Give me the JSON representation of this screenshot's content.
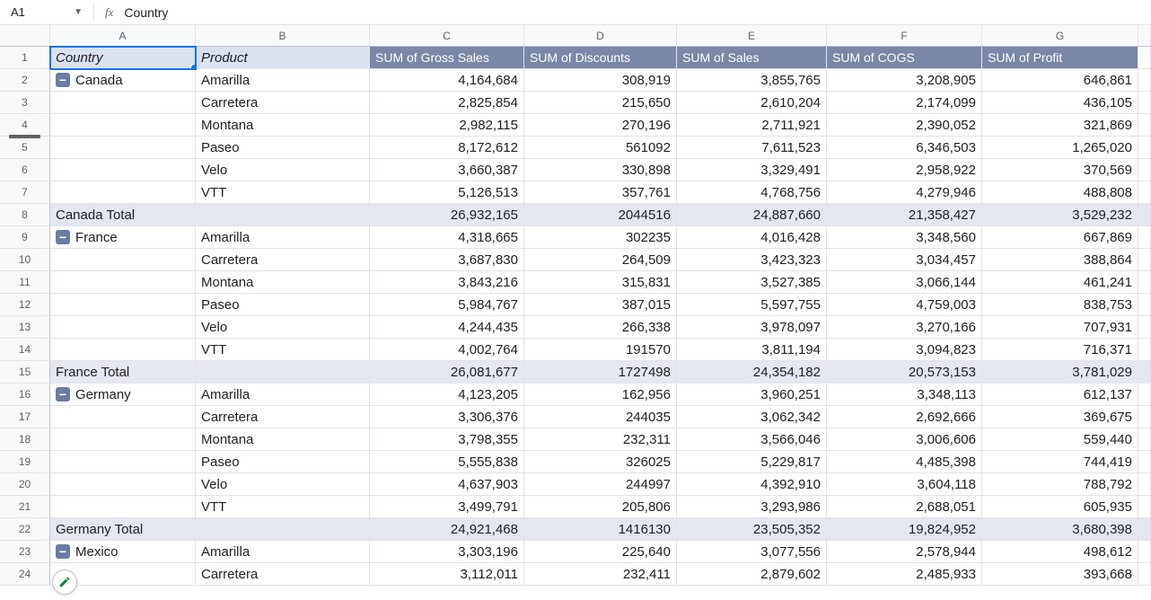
{
  "namebox": {
    "ref": "A1"
  },
  "formula_bar": {
    "fx_label": "fx",
    "value": "Country"
  },
  "columns": [
    "A",
    "B",
    "C",
    "D",
    "E",
    "F",
    "G"
  ],
  "headers": {
    "country_label": "Country",
    "product_label": "Product",
    "metrics": [
      "SUM of Gross Sales",
      "SUM of Discounts",
      "SUM of Sales",
      "SUM of COGS",
      "SUM of Profit"
    ]
  },
  "row_numbers": [
    1,
    2,
    3,
    4,
    5,
    6,
    7,
    8,
    9,
    10,
    11,
    12,
    13,
    14,
    15,
    16,
    17,
    18,
    19,
    20,
    21,
    22,
    23,
    24
  ],
  "rows": [
    {
      "type": "product",
      "r": 2,
      "country": "Canada",
      "first": true,
      "product": "Amarilla",
      "vals": [
        "4,164,684",
        "308,919",
        "3,855,765",
        "3,208,905",
        "646,861"
      ]
    },
    {
      "type": "product",
      "r": 3,
      "product": "Carretera",
      "vals": [
        "2,825,854",
        "215,650",
        "2,610,204",
        "2,174,099",
        "436,105"
      ]
    },
    {
      "type": "product",
      "r": 4,
      "product": "Montana",
      "vals": [
        "2,982,115",
        "270,196",
        "2,711,921",
        "2,390,052",
        "321,869"
      ]
    },
    {
      "type": "product",
      "r": 5,
      "product": "Paseo",
      "vals": [
        "8,172,612",
        "561092",
        "7,611,523",
        "6,346,503",
        "1,265,020"
      ]
    },
    {
      "type": "product",
      "r": 6,
      "product": "Velo",
      "vals": [
        "3,660,387",
        "330,898",
        "3,329,491",
        "2,958,922",
        "370,569"
      ]
    },
    {
      "type": "product",
      "r": 7,
      "product": "VTT",
      "vals": [
        "5,126,513",
        "357,761",
        "4,768,756",
        "4,279,946",
        "488,808"
      ]
    },
    {
      "type": "total",
      "r": 8,
      "label": "Canada Total",
      "vals": [
        "26,932,165",
        "2044516",
        "24,887,660",
        "21,358,427",
        "3,529,232"
      ]
    },
    {
      "type": "product",
      "r": 9,
      "country": "France",
      "first": true,
      "product": "Amarilla",
      "vals": [
        "4,318,665",
        "302235",
        "4,016,428",
        "3,348,560",
        "667,869"
      ]
    },
    {
      "type": "product",
      "r": 10,
      "product": "Carretera",
      "vals": [
        "3,687,830",
        "264,509",
        "3,423,323",
        "3,034,457",
        "388,864"
      ]
    },
    {
      "type": "product",
      "r": 11,
      "product": "Montana",
      "vals": [
        "3,843,216",
        "315,831",
        "3,527,385",
        "3,066,144",
        "461,241"
      ]
    },
    {
      "type": "product",
      "r": 12,
      "product": "Paseo",
      "vals": [
        "5,984,767",
        "387,015",
        "5,597,755",
        "4,759,003",
        "838,753"
      ]
    },
    {
      "type": "product",
      "r": 13,
      "product": "Velo",
      "vals": [
        "4,244,435",
        "266,338",
        "3,978,097",
        "3,270,166",
        "707,931"
      ]
    },
    {
      "type": "product",
      "r": 14,
      "product": "VTT",
      "vals": [
        "4,002,764",
        "191570",
        "3,811,194",
        "3,094,823",
        "716,371"
      ]
    },
    {
      "type": "total",
      "r": 15,
      "label": "France Total",
      "vals": [
        "26,081,677",
        "1727498",
        "24,354,182",
        "20,573,153",
        "3,781,029"
      ]
    },
    {
      "type": "product",
      "r": 16,
      "country": "Germany",
      "first": true,
      "product": "Amarilla",
      "vals": [
        "4,123,205",
        "162,956",
        "3,960,251",
        "3,348,113",
        "612,137"
      ]
    },
    {
      "type": "product",
      "r": 17,
      "product": "Carretera",
      "vals": [
        "3,306,376",
        "244035",
        "3,062,342",
        "2,692,666",
        "369,675"
      ]
    },
    {
      "type": "product",
      "r": 18,
      "product": "Montana",
      "vals": [
        "3,798,355",
        "232,311",
        "3,566,046",
        "3,006,606",
        "559,440"
      ]
    },
    {
      "type": "product",
      "r": 19,
      "product": "Paseo",
      "vals": [
        "5,555,838",
        "326025",
        "5,229,817",
        "4,485,398",
        "744,419"
      ]
    },
    {
      "type": "product",
      "r": 20,
      "product": "Velo",
      "vals": [
        "4,637,903",
        "244997",
        "4,392,910",
        "3,604,118",
        "788,792"
      ]
    },
    {
      "type": "product",
      "r": 21,
      "product": "VTT",
      "vals": [
        "3,499,791",
        "205,806",
        "3,293,986",
        "2,688,051",
        "605,935"
      ]
    },
    {
      "type": "total",
      "r": 22,
      "label": "Germany Total",
      "vals": [
        "24,921,468",
        "1416130",
        "23,505,352",
        "19,824,952",
        "3,680,398"
      ]
    },
    {
      "type": "product",
      "r": 23,
      "country": "Mexico",
      "first": true,
      "product": "Amarilla",
      "vals": [
        "3,303,196",
        "225,640",
        "3,077,556",
        "2,578,944",
        "498,612"
      ]
    },
    {
      "type": "product",
      "r": 24,
      "product": "Carretera",
      "vals": [
        "3,112,011",
        "232,411",
        "2,879,602",
        "2,485,933",
        "393,668"
      ]
    }
  ]
}
